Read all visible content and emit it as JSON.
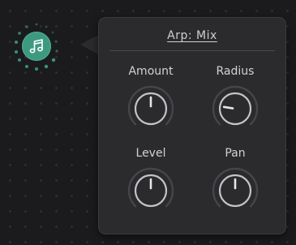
{
  "node": {
    "icon": "music-notes-icon",
    "color": "#3d9a80"
  },
  "popover": {
    "title": "Arp: Mix",
    "knobs": [
      {
        "label": "Amount",
        "icon": "knob",
        "value": 0.5
      },
      {
        "label": "Radius",
        "icon": "knob",
        "value": 0.2
      },
      {
        "label": "Level",
        "icon": "knob",
        "value": 0.5
      },
      {
        "label": "Pan",
        "icon": "knob",
        "value": 0.5
      }
    ]
  },
  "colors": {
    "background": "#1b1b1d",
    "panel": "#2b2b2e",
    "accent": "#3d9a80",
    "knob_ring": "#9a9a9e",
    "text": "#d2d2d5"
  }
}
